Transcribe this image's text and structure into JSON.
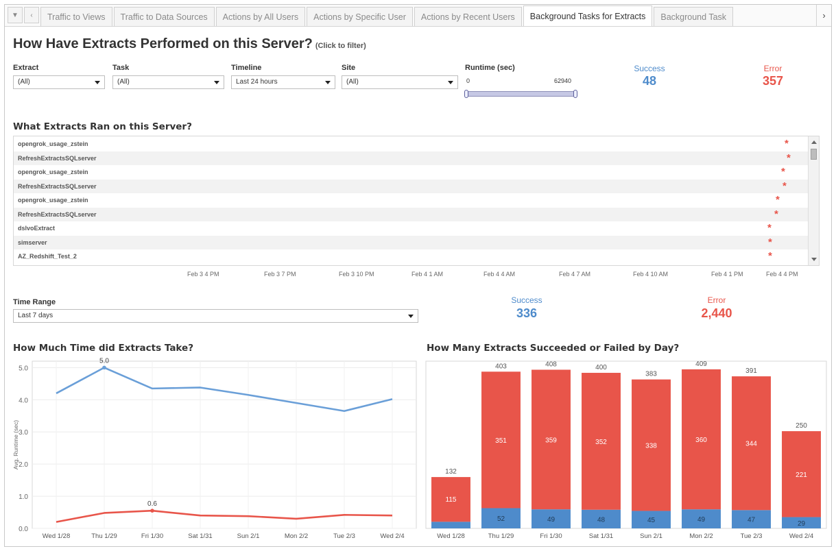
{
  "tabs": [
    {
      "label": "Traffic to Views",
      "active": false
    },
    {
      "label": "Traffic to Data Sources",
      "active": false
    },
    {
      "label": "Actions by All Users",
      "active": false
    },
    {
      "label": "Actions by Specific User",
      "active": false
    },
    {
      "label": "Actions by Recent Users",
      "active": false
    },
    {
      "label": "Background Tasks for Extracts",
      "active": true
    },
    {
      "label": "Background Task",
      "active": false
    }
  ],
  "title": "How Have Extracts Performed on this Server?",
  "title_hint": "(Click to filter)",
  "filters": {
    "extract": {
      "label": "Extract",
      "value": "(All)"
    },
    "task": {
      "label": "Task",
      "value": "(All)"
    },
    "timeline": {
      "label": "Timeline",
      "value": "Last 24 hours"
    },
    "site": {
      "label": "Site",
      "value": "(All)"
    },
    "runtime": {
      "label": "Runtime (sec)",
      "min": "0",
      "max": "62940"
    }
  },
  "kpi_top": {
    "success_label": "Success",
    "success_value": "48",
    "error_label": "Error",
    "error_value": "357"
  },
  "gantt": {
    "title": "What Extracts Ran on this Server?",
    "rows": [
      {
        "name": "opengrok_usage_zstein",
        "marker": "*"
      },
      {
        "name": "RefreshExtractsSQLserver",
        "marker": "*"
      },
      {
        "name": "opengrok_usage_zstein",
        "marker": "*"
      },
      {
        "name": "RefreshExtractsSQLserver",
        "marker": "*"
      },
      {
        "name": "opengrok_usage_zstein",
        "marker": "*"
      },
      {
        "name": "RefreshExtractsSQLserver",
        "marker": "*"
      },
      {
        "name": "dslvoExtract",
        "marker": "*"
      },
      {
        "name": "simserver",
        "marker": "*"
      },
      {
        "name": "AZ_Redshift_Test_2",
        "marker": "*"
      }
    ],
    "axis_labels": [
      "Feb 3 4 PM",
      "Feb 3 7 PM",
      "Feb 3 10 PM",
      "Feb 4 1 AM",
      "Feb 4 4 AM",
      "Feb 4 7 AM",
      "Feb 4 10 AM",
      "Feb 4 1 PM",
      "Feb 4 4 PM"
    ]
  },
  "time_range": {
    "label": "Time Range",
    "value": "Last 7 days"
  },
  "kpi_bottom": {
    "success_label": "Success",
    "success_value": "336",
    "error_label": "Error",
    "error_value": "2,440"
  },
  "colors": {
    "success": "#4e8bcb",
    "error": "#e8554a",
    "success_line": "#6a9fd8"
  },
  "chart_data": [
    {
      "type": "line",
      "title": "How Much Time did Extracts Take?",
      "ylabel": "Avg. Runtime (sec)",
      "xlabel": "",
      "categories": [
        "Wed 1/28",
        "Thu 1/29",
        "Fri 1/30",
        "Sat 1/31",
        "Sun 2/1",
        "Mon 2/2",
        "Tue 2/3",
        "Wed 2/4"
      ],
      "ylim": [
        0,
        5.2
      ],
      "yticks": [
        "0.0",
        "1.0",
        "2.0",
        "3.0",
        "4.0",
        "5.0"
      ],
      "grid": true,
      "series": [
        {
          "values": [
            4.2,
            5.0,
            4.35,
            4.38,
            4.15,
            3.9,
            3.65,
            4.02
          ],
          "color": "#6a9fd8",
          "label_index": 1,
          "label_text": "5.0"
        },
        {
          "values": [
            0.2,
            0.48,
            0.55,
            0.4,
            0.38,
            0.3,
            0.42,
            0.4
          ],
          "color": "#e8554a",
          "label_index": 2,
          "label_text": "0.6"
        }
      ]
    },
    {
      "type": "bar",
      "title": "How Many Extracts Succeeded or Failed by Day?",
      "categories": [
        "Wed 1/28",
        "Thu 1/29",
        "Fri 1/30",
        "Sat 1/31",
        "Sun 2/1",
        "Mon 2/2",
        "Tue 2/3",
        "Wed 2/4"
      ],
      "stacked": true,
      "totals": [
        132,
        403,
        408,
        400,
        383,
        409,
        391,
        250
      ],
      "ylim": [
        0,
        430
      ],
      "series": [
        {
          "name": "Success",
          "values": [
            17,
            52,
            49,
            48,
            45,
            49,
            47,
            29
          ],
          "color": "#4e8bcb",
          "labels": [
            "",
            "52",
            "49",
            "48",
            "45",
            "49",
            "47",
            "29"
          ]
        },
        {
          "name": "Error",
          "values": [
            115,
            351,
            359,
            352,
            338,
            360,
            344,
            221
          ],
          "color": "#e8554a",
          "labels": [
            "115",
            "351",
            "359",
            "352",
            "338",
            "360",
            "344",
            "221"
          ]
        }
      ]
    }
  ]
}
